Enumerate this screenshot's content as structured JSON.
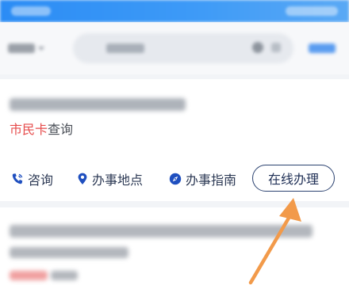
{
  "card1": {
    "tag_highlight": "市民卡",
    "tag_rest": "查询",
    "actions": {
      "consult": "咨询",
      "location": "办事地点",
      "guide": "办事指南",
      "online": "在线办理"
    }
  },
  "colors": {
    "status_bar": "#3d9af7",
    "tag_red": "#e64b4b",
    "button_border": "#2b4270",
    "action_icon": "#1f4fbf",
    "annotation_arrow": "#f29a4a"
  },
  "icons": [
    "phone-icon",
    "location-pin-icon",
    "compass-icon",
    "chevron-down-icon",
    "search-icon",
    "close-icon"
  ]
}
